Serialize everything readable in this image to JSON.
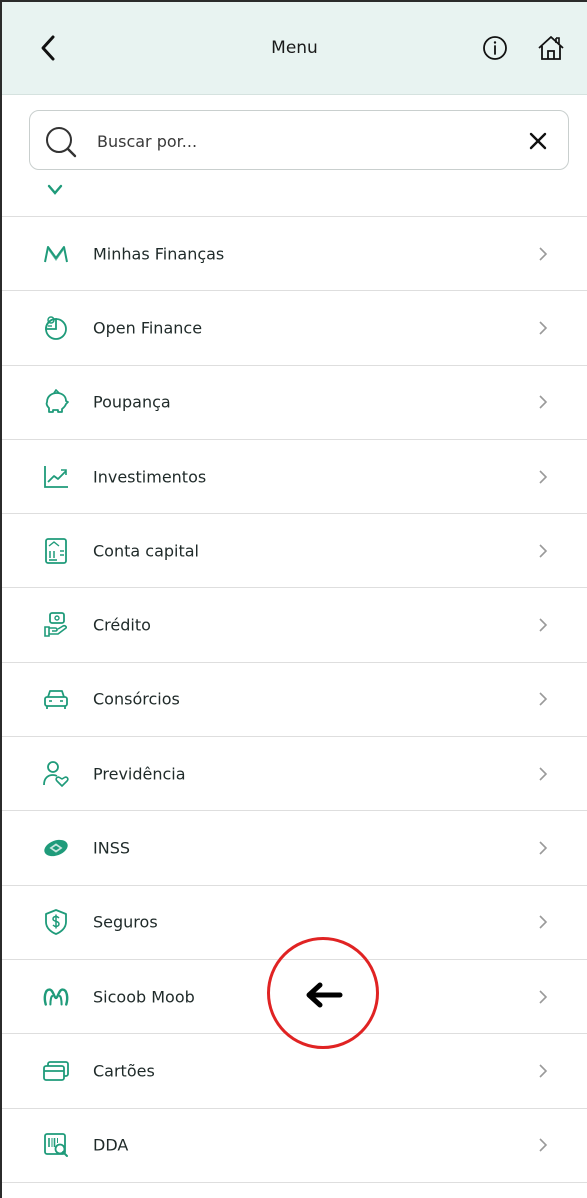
{
  "header": {
    "title": "Menu",
    "back_icon": "chevron-left-icon",
    "info_icon": "info-circle-icon",
    "home_icon": "home-icon"
  },
  "search": {
    "placeholder": "Buscar por...",
    "value": "",
    "search_icon": "search-icon",
    "clear_icon": "close-icon"
  },
  "menu": {
    "items": [
      {
        "label": "Minhas Finanças",
        "icon": "finances-m-icon"
      },
      {
        "label": "Open Finance",
        "icon": "open-finance-icon"
      },
      {
        "label": "Poupança",
        "icon": "piggy-bank-icon"
      },
      {
        "label": "Investimentos",
        "icon": "chart-trend-icon"
      },
      {
        "label": "Conta capital",
        "icon": "bank-document-icon"
      },
      {
        "label": "Crédito",
        "icon": "credit-hand-icon"
      },
      {
        "label": "Consórcios",
        "icon": "car-icon"
      },
      {
        "label": "Previdência",
        "icon": "person-heart-icon"
      },
      {
        "label": "INSS",
        "icon": "inss-logo-icon"
      },
      {
        "label": "Seguros",
        "icon": "shield-dollar-icon"
      },
      {
        "label": "Sicoob Moob",
        "icon": "moob-logo-icon"
      },
      {
        "label": "Cartões",
        "icon": "cards-icon"
      },
      {
        "label": "DDA",
        "icon": "barcode-search-icon"
      }
    ]
  },
  "colors": {
    "accent": "#1f9b7a",
    "header_bg": "#e8f3f1",
    "annotation": "#e02323"
  }
}
